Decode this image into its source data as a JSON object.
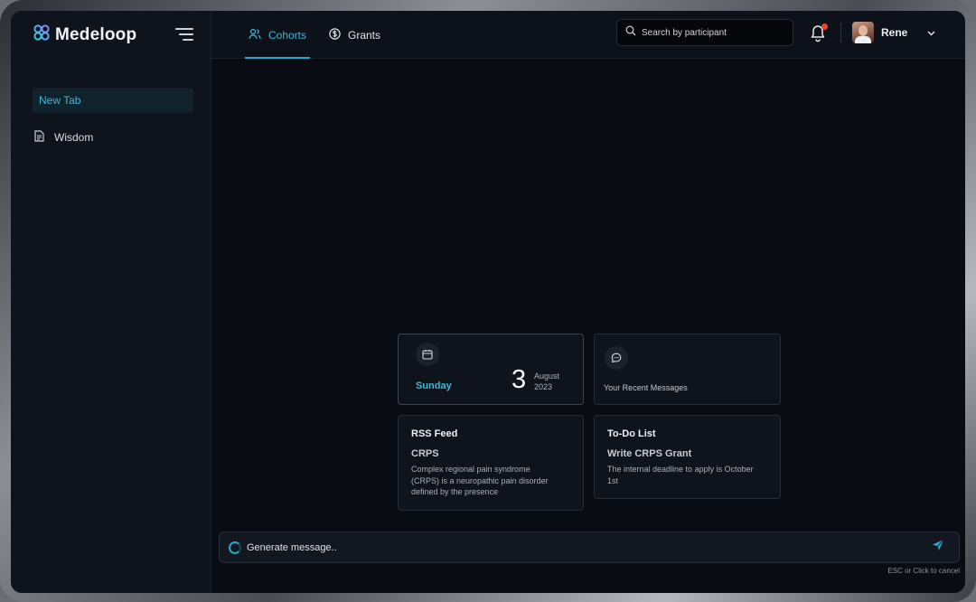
{
  "app": {
    "brand_name": "Medeloop",
    "accent_color": "#2aa6c8",
    "notification_color": "#f0412c"
  },
  "sidebar": {
    "items": [
      {
        "label": "New Tab",
        "active": true
      },
      {
        "label": "Wisdom",
        "icon": "document-icon",
        "active": false
      }
    ]
  },
  "header": {
    "tabs": [
      {
        "label": "Cohorts",
        "icon": "users-icon",
        "active": true
      },
      {
        "label": "Grants",
        "icon": "dollar-circle-icon",
        "active": false
      }
    ],
    "search": {
      "placeholder": "Search by participant"
    },
    "notifications": {
      "has_unread": true
    },
    "user": {
      "name": "Rene"
    }
  },
  "cards": {
    "date": {
      "weekday": "Sunday",
      "day": "3",
      "month": "August",
      "year": "2023",
      "icon": "calendar-icon"
    },
    "messages": {
      "label": "Your Recent Messages",
      "icon": "chat-icon"
    },
    "rss": {
      "title": "RSS Feed",
      "subtitle": "CRPS",
      "body": "Complex regional pain syndrome (CRPS) is a neuropathic pain disorder defined by the presence"
    },
    "todo": {
      "title": "To-Do List",
      "subtitle": "Write CRPS Grant",
      "body": "The internal deadline to apply is October 1st"
    }
  },
  "composer": {
    "placeholder": "Generate message..",
    "hint": "ESC or Click to cancel"
  }
}
